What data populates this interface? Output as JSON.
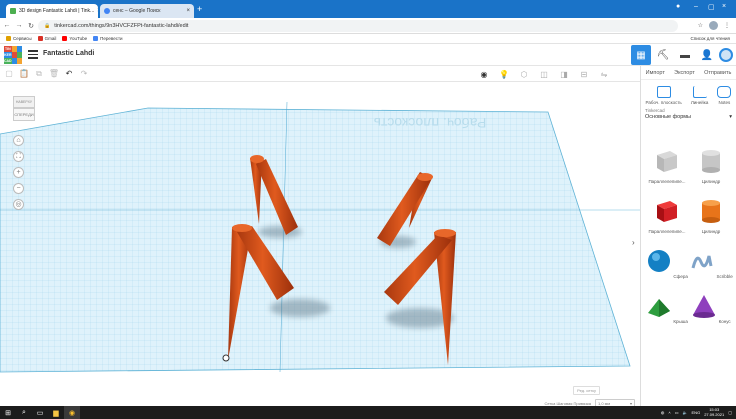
{
  "browser": {
    "tabs": [
      {
        "title": "3D design Fantastic Lahdi | Tink...",
        "active": true,
        "favicon_color": "#4caf50"
      },
      {
        "title": "сенс – Google Поиск",
        "active": false,
        "favicon_color": "#4285f4"
      }
    ],
    "new_tab": "+",
    "url": "tinkercad.com/things/9n3HVCFZFPt-fantastic-lahdi/edit",
    "bookmarks": [
      {
        "label": "Сервисы",
        "color": "#e0a000"
      },
      {
        "label": "Gmail",
        "color": "#d93025"
      },
      {
        "label": "YouTube",
        "color": "#ff0000"
      },
      {
        "label": "Перевести",
        "color": "#4285f4"
      }
    ],
    "reading_list": "Список для чтения"
  },
  "app": {
    "logo_letters": [
      "TIN",
      "KER",
      "CAD",
      "",
      "",
      "",
      "",
      "",
      ""
    ],
    "project_title": "Fantastic Lahdi"
  },
  "panel": {
    "tabs": [
      "Импорт",
      "Экспорт",
      "Отправить"
    ],
    "categories": [
      {
        "label": "Рабоч. плоскость"
      },
      {
        "label": "Линейка"
      },
      {
        "label": "Notes"
      }
    ],
    "library_label": "Tinkercad",
    "library_value": "Основные формы",
    "shapes": [
      {
        "label": "Параллелепипе...",
        "kind": "box-hole"
      },
      {
        "label": "Цилиндр",
        "kind": "cyl-hole"
      },
      {
        "label": "Параллелепипе...",
        "kind": "box-red"
      },
      {
        "label": "Цилиндр",
        "kind": "cyl-orange"
      },
      {
        "label": "Сфера",
        "kind": "sphere"
      },
      {
        "label": "Scribble",
        "kind": "scribble"
      },
      {
        "label": "Крыша",
        "kind": "roof"
      },
      {
        "label": "Конус",
        "kind": "cone"
      }
    ]
  },
  "canvas": {
    "viewcube_top": "НАВЕРХУ",
    "viewcube_front": "СПЕРЕДИ",
    "workplane_text": "Рабоч. плоскость",
    "edit_grid": "Ред. сетку",
    "snap_label": "Сетка Шаговая Привязка",
    "snap_value": "1,0 мм"
  },
  "taskbar": {
    "lang": "ENG",
    "time": "15:03",
    "date": "27.09.2021"
  }
}
